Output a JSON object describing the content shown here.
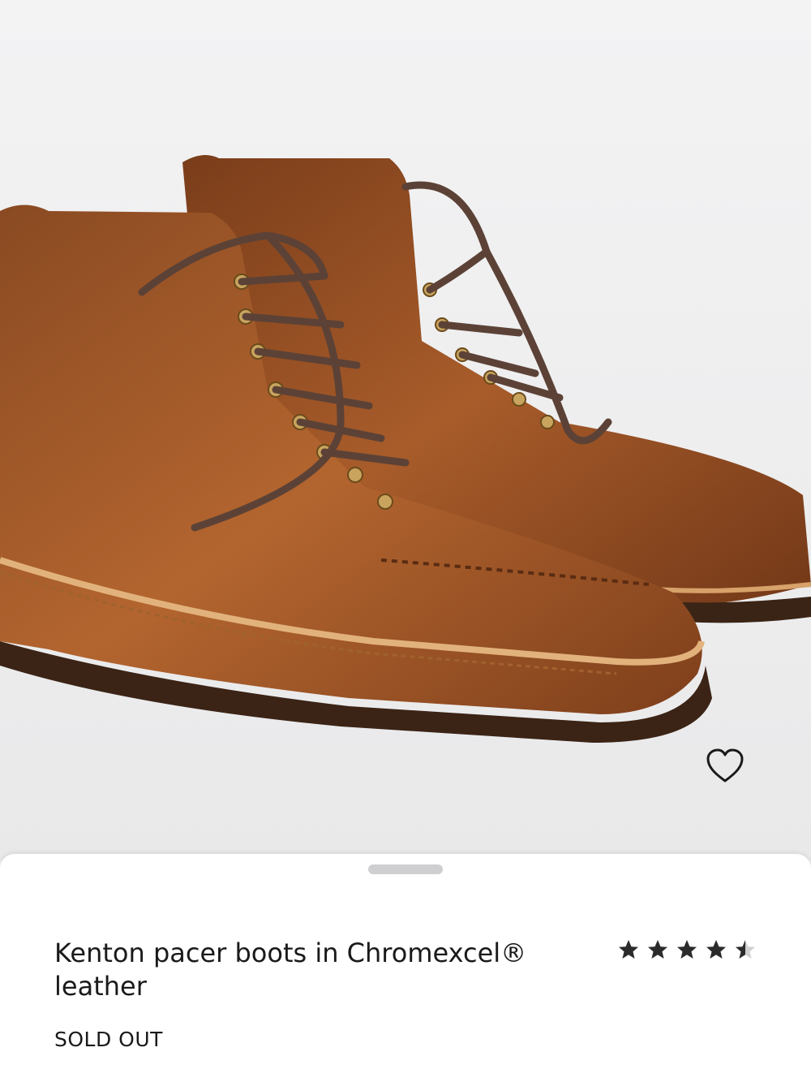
{
  "product": {
    "name": "Kenton pacer boots in Chromexcel® leather",
    "status": "SOLD OUT",
    "rating": 4.5,
    "rating_max": 5
  },
  "image": {
    "subject": "boots-product-photo"
  },
  "icons": {
    "favorite": "heart-icon",
    "star": "star-icon"
  },
  "colors": {
    "text": "#1a1a1a",
    "star": "#2b2b2b",
    "star_empty": "#d0d0d0",
    "sheet_bg": "#ffffff"
  }
}
